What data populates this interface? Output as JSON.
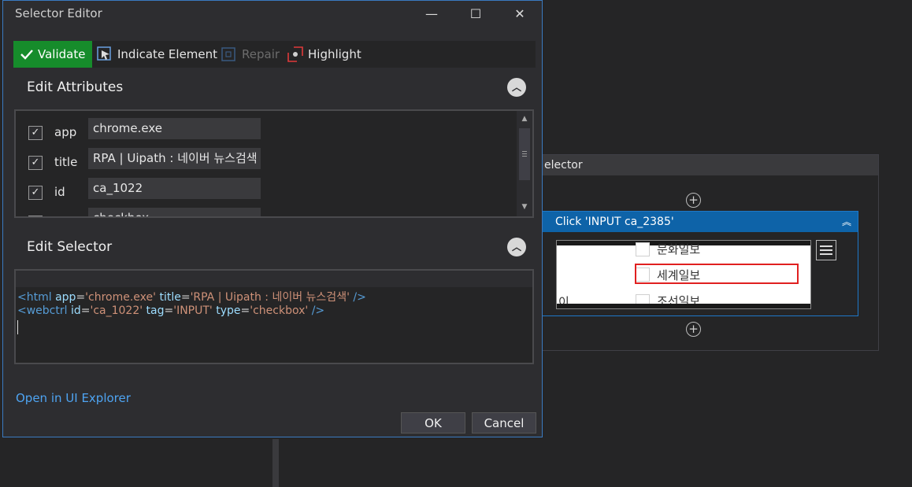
{
  "dialog": {
    "title": "Selector Editor",
    "window_controls": {
      "minimize": "—",
      "maximize": "☐",
      "close": "✕"
    },
    "toolbar": {
      "validate_label": "Validate",
      "indicate_label": "Indicate Element",
      "repair_label": "Repair",
      "highlight_label": "Highlight"
    },
    "edit_attributes": {
      "title": "Edit Attributes",
      "rows": [
        {
          "checked": true,
          "name": "app",
          "value": "chrome.exe"
        },
        {
          "checked": true,
          "name": "title",
          "value": "RPA | Uipath : 네이버 뉴스검색"
        },
        {
          "checked": true,
          "name": "id",
          "value": "ca_1022"
        },
        {
          "checked": true,
          "name": "type",
          "value": "checkbox"
        }
      ]
    },
    "edit_selector": {
      "title": "Edit Selector",
      "line1": {
        "open": "<html",
        "app_attr": " app",
        "app_val": "'chrome.exe'",
        "title_attr": " title",
        "title_val": "'RPA | Uipath : 네이버 뉴스검색'",
        "close": " />"
      },
      "line2": {
        "open": "<webctrl",
        "id_attr": " id",
        "id_val": "'ca_1022'",
        "tag_attr": " tag",
        "tag_val": "'INPUT'",
        "type_attr": " type",
        "type_val": "'checkbox'",
        "close": " />"
      },
      "eq": "="
    },
    "open_in_explorer": "Open in UI Explorer",
    "ok_label": "OK",
    "cancel_label": "Cancel"
  },
  "background": {
    "container_title": "elector",
    "activity_title": "Click 'INPUT  ca_2385'",
    "preview": {
      "item1": "문화일보",
      "item2": "세계일보",
      "item3": "조선일보",
      "left_char": "이"
    },
    "plus": "+"
  },
  "colors": {
    "validate_bg": "#168c2b",
    "activity_header": "#0e63a8",
    "link": "#4ea4f2",
    "selection_box": "#e02020"
  }
}
